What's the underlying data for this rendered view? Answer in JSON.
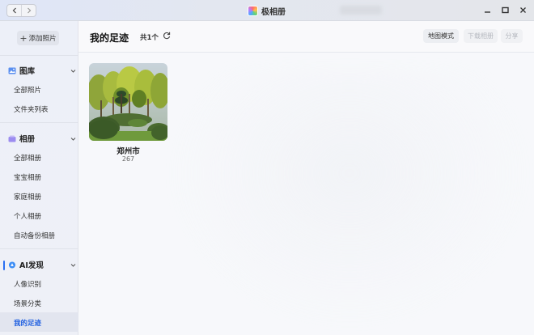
{
  "window": {
    "title": "极相册"
  },
  "sidebar": {
    "add_photo_label": "添加照片",
    "sections": [
      {
        "label": "图库",
        "items": [
          "全部照片",
          "文件夹列表"
        ]
      },
      {
        "label": "相册",
        "items": [
          "全部相册",
          "宝宝相册",
          "家庭相册",
          "个人相册",
          "自动备份相册"
        ]
      },
      {
        "label": "AI发现",
        "items": [
          "人像识别",
          "场景分类",
          "我的足迹"
        ]
      }
    ],
    "active_item": "我的足迹"
  },
  "main": {
    "page_title": "我的足迹",
    "total_label": "共1个",
    "buttons": {
      "map_mode": "地图模式",
      "download": "下载相册",
      "share": "分享"
    },
    "cards": [
      {
        "name": "郑州市",
        "count": "267"
      }
    ]
  },
  "colors": {
    "accent": "#1f5fe0",
    "sidebar_bg": "#edf0f8",
    "main_bg": "#f7f8fb"
  }
}
